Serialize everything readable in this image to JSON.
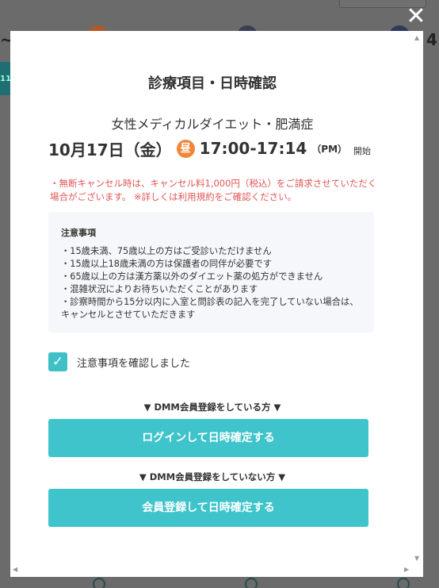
{
  "background": {
    "time_fragment": "4:",
    "tilde_fragment": "~",
    "strip_fragment": "11"
  },
  "modal": {
    "close_glyph": "✕",
    "title": "診療項目・日時確認",
    "menu_name": "女性メディカルダイエット・肥満症",
    "date": "10月17日（金）",
    "period_badge": "昼",
    "time_range": "17:00-17:14",
    "period_label": "（PM）",
    "start_label": "開始",
    "cancel_note": "・無断キャンセル時は、キャンセル料1,000円（税込）をご請求させていただく場合がございます。 ※詳しくは利用規約をご確認ください。",
    "notice": {
      "title": "注意事項",
      "items": [
        "・15歳未満、75歳以上の方はご受診いただけません",
        "・15歳以上18歳未満の方は保護者の同伴が必要です",
        "・65歳以上の方は漢方薬以外のダイエット薬の処方ができません",
        "・混雑状況によりお待ちいただくことがあります",
        "・診察時間から15分以内に入室と問診表の記入を完了していない場合は、キャンセルとさせていただきます"
      ]
    },
    "checkbox": {
      "checked": true,
      "check_glyph": "✓",
      "label": "注意事項を確認しました"
    },
    "member_section": {
      "label": "▼ DMM会員登録をしている方 ▼",
      "button": "ログインして日時確定する"
    },
    "nonmember_section": {
      "label": "▼ DMM会員登録をしていない方 ▼",
      "button": "会員登録して日時確定する"
    }
  },
  "colors": {
    "accent": "#3fc4cb",
    "badge_orange": "#f0883a",
    "warning_red": "#e25555"
  }
}
